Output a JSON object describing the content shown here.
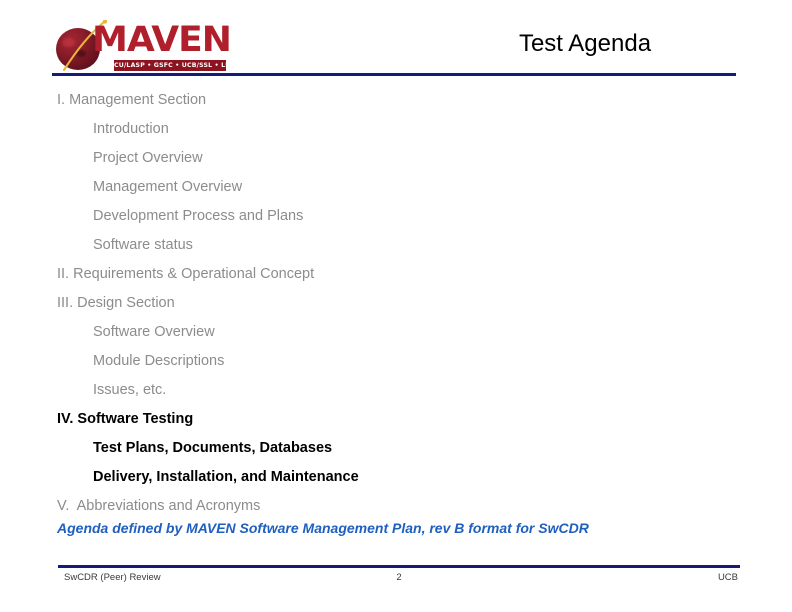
{
  "header": {
    "title": "Test Agenda",
    "logo": {
      "wordmark": "MAVEN",
      "partners": "CU/LASP • GSFC • UCB/SSL • LM • JPL",
      "planet_color": "#8c1e2a",
      "orbit_color": "#e8b63a",
      "wordmark_color": "#b01f2c"
    },
    "rule_color": "#161a79"
  },
  "agenda": {
    "items": [
      {
        "text": "I. Management Section",
        "level": 1,
        "emphasis": "gray"
      },
      {
        "text": "Introduction",
        "level": 2,
        "emphasis": "gray"
      },
      {
        "text": "Project Overview",
        "level": 2,
        "emphasis": "gray"
      },
      {
        "text": "Management Overview",
        "level": 2,
        "emphasis": "gray"
      },
      {
        "text": "Development Process and Plans",
        "level": 2,
        "emphasis": "gray"
      },
      {
        "text": "Software status",
        "level": 2,
        "emphasis": "gray"
      },
      {
        "text": "II. Requirements & Operational Concept",
        "level": 1,
        "emphasis": "gray"
      },
      {
        "text": "III. Design Section",
        "level": 1,
        "emphasis": "gray"
      },
      {
        "text": "Software Overview",
        "level": 2,
        "emphasis": "gray"
      },
      {
        "text": "Module Descriptions",
        "level": 2,
        "emphasis": "gray"
      },
      {
        "text": "Issues, etc.",
        "level": 2,
        "emphasis": "gray"
      },
      {
        "text": "IV. Software Testing",
        "level": 1,
        "emphasis": "dark"
      },
      {
        "text": "Test Plans, Documents, Databases",
        "level": 2,
        "emphasis": "dark"
      },
      {
        "text": "Delivery, Installation, and Maintenance",
        "level": 2,
        "emphasis": "dark"
      },
      {
        "text": "V.  Abbreviations and Acronyms",
        "level": 1,
        "emphasis": "gray"
      }
    ],
    "gray_color": "#8c8c8c",
    "dark_color": "#000000"
  },
  "note": {
    "text": "Agenda defined by MAVEN Software Management Plan, rev B format for SwCDR",
    "color": "#1f5fbf"
  },
  "footer": {
    "left": "SwCDR (Peer) Review",
    "center": "2",
    "right": "UCB",
    "rule_color": "#161a79"
  }
}
